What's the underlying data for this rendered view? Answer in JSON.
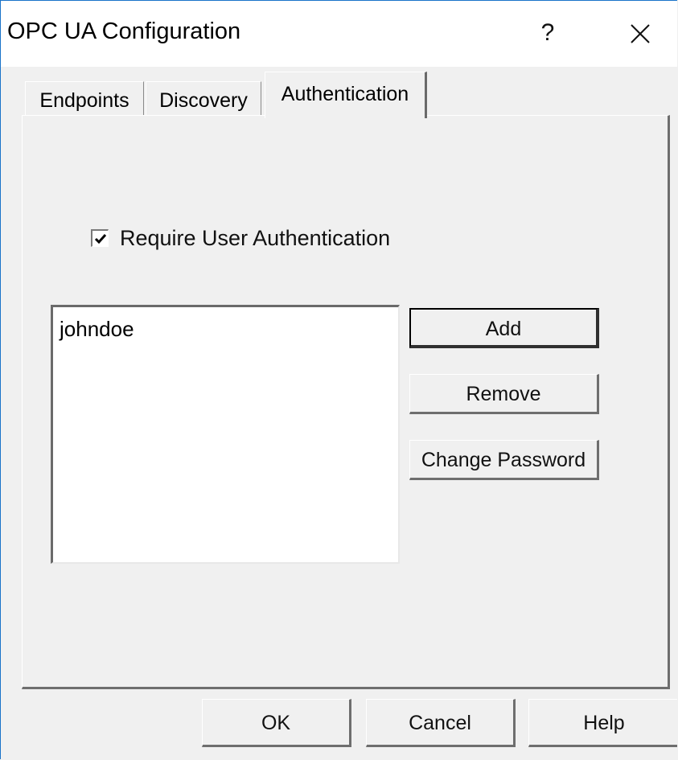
{
  "window": {
    "title": "OPC UA Configuration",
    "help_label": "?",
    "accent": "#1a73c9"
  },
  "tabs": [
    {
      "label": "Endpoints",
      "selected": false
    },
    {
      "label": "Discovery",
      "selected": false
    },
    {
      "label": "Authentication",
      "selected": true
    }
  ],
  "auth": {
    "require_label": "Require User Authentication",
    "require_checked": true,
    "users": [
      "johndoe"
    ],
    "add_label": "Add",
    "remove_label": "Remove",
    "change_password_label": "Change Password"
  },
  "footer": {
    "ok_label": "OK",
    "cancel_label": "Cancel",
    "help_label": "Help"
  }
}
